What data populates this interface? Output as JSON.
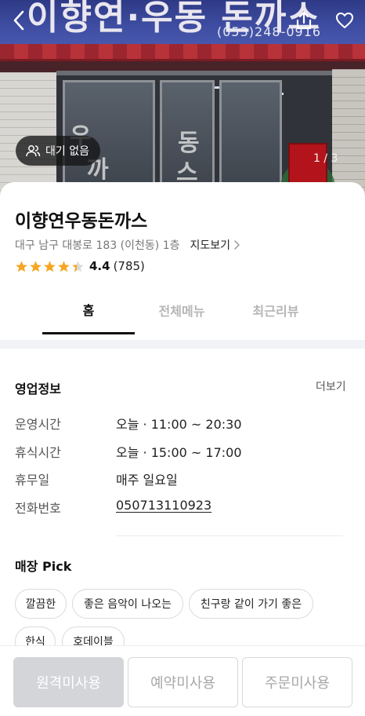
{
  "hero": {
    "sign_text": "이향연·우동 돈까스",
    "sign_phone": "(053)248-0916",
    "glass_chars": [
      "우",
      "동",
      "까",
      "스"
    ],
    "wait_badge": "대기 없음",
    "photo_counter": "1 / 3"
  },
  "store": {
    "name": "이향연우동돈까스",
    "address": "대구 남구 대봉로 183 (이천동) 1층",
    "map_link": "지도보기",
    "rating": "4.4",
    "rating_value": 4.4,
    "review_count": "(785)"
  },
  "tabs": [
    {
      "label": "홈",
      "active": true
    },
    {
      "label": "전체메뉴",
      "active": false
    },
    {
      "label": "최근리뷰",
      "active": false
    }
  ],
  "business_info": {
    "title": "영업정보",
    "more": "더보기",
    "rows": [
      {
        "label": "운영시간",
        "value": "오늘 · 11:00 ~ 20:30"
      },
      {
        "label": "휴식시간",
        "value": "오늘 · 15:00 ~ 17:00"
      },
      {
        "label": "휴무일",
        "value": "매주 일요일"
      },
      {
        "label": "전화번호",
        "value": "050713110923"
      }
    ]
  },
  "store_pick": {
    "title": "매장 Pick",
    "chips": [
      "깔끔한",
      "좋은 음악이 나오는",
      "친구랑 같이 가기 좋은",
      "한식",
      "호데이블"
    ]
  },
  "bottom_buttons": [
    "원격미사용",
    "예약미사용",
    "주문미사용"
  ],
  "colors": {
    "star": "#f5a623",
    "star_empty": "#d9d9d9",
    "inactive_tab": "#b6b6b6",
    "disabled_button": "#d3d5d9"
  }
}
